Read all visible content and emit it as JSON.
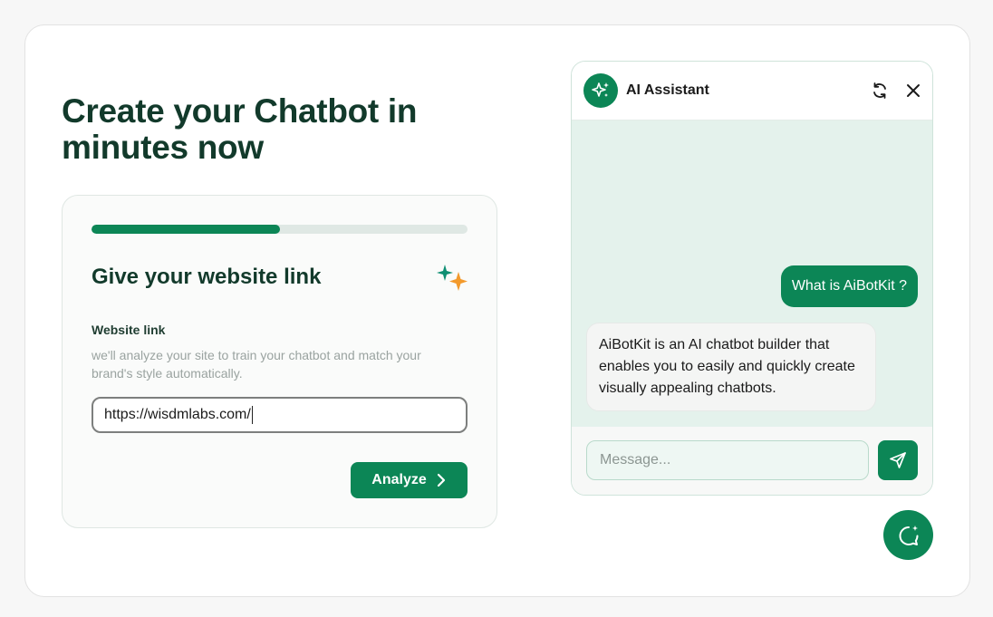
{
  "hero": {
    "title": "Create your Chatbot in minutes now"
  },
  "form": {
    "progress_fraction": 0.5,
    "step_title": "Give your website link",
    "field_label": "Website link",
    "field_help": "we'll analyze your site to train your chatbot and match your brand's style automatically.",
    "url_value": "https://wisdmlabs.com/",
    "analyze_label": "Analyze",
    "icons": {
      "sparkle": "sparkle-icon",
      "chevron": "chevron-right-icon"
    }
  },
  "chat": {
    "assistant_name": "AI Assistant",
    "messages": [
      {
        "from": "user",
        "text": "What is AiBotKit ?"
      },
      {
        "from": "bot",
        "text": "AiBotKit is an AI chatbot builder that enables you to easily and quickly create visually appealing chatbots."
      }
    ],
    "message_placeholder": "Message...",
    "icons": {
      "avatar": "sparkle-icon",
      "refresh": "refresh-icon",
      "close": "close-icon",
      "send": "send-icon",
      "launcher": "chat-bubble-icon"
    }
  },
  "colors": {
    "brand_green": "#0c8656",
    "heading": "#123a2b",
    "chat_background": "#e4f2ec",
    "sparkle_orange": "#f39a2c",
    "sparkle_teal": "#0f8f73"
  }
}
